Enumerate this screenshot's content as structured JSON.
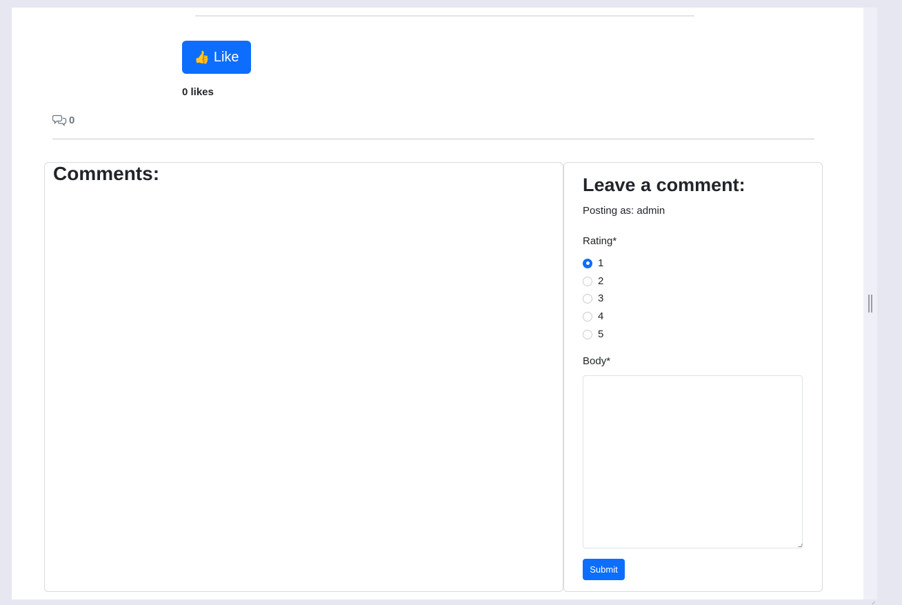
{
  "post": {
    "like_label": "Like",
    "like_icon": "👍",
    "likes_text": "0 likes",
    "comment_count": "0"
  },
  "comments": {
    "title": "Comments:",
    "items": []
  },
  "form": {
    "title": "Leave a comment:",
    "posting_as": "Posting as: admin",
    "rating_label": "Rating*",
    "rating_options": [
      "1",
      "2",
      "3",
      "4",
      "5"
    ],
    "selected_rating": "1",
    "body_label": "Body*",
    "body_value": "",
    "submit_label": "Submit"
  },
  "colors": {
    "primary": "#0d6efd",
    "page_background": "#e6e7f1",
    "text": "#212529",
    "muted": "#6c757d"
  }
}
